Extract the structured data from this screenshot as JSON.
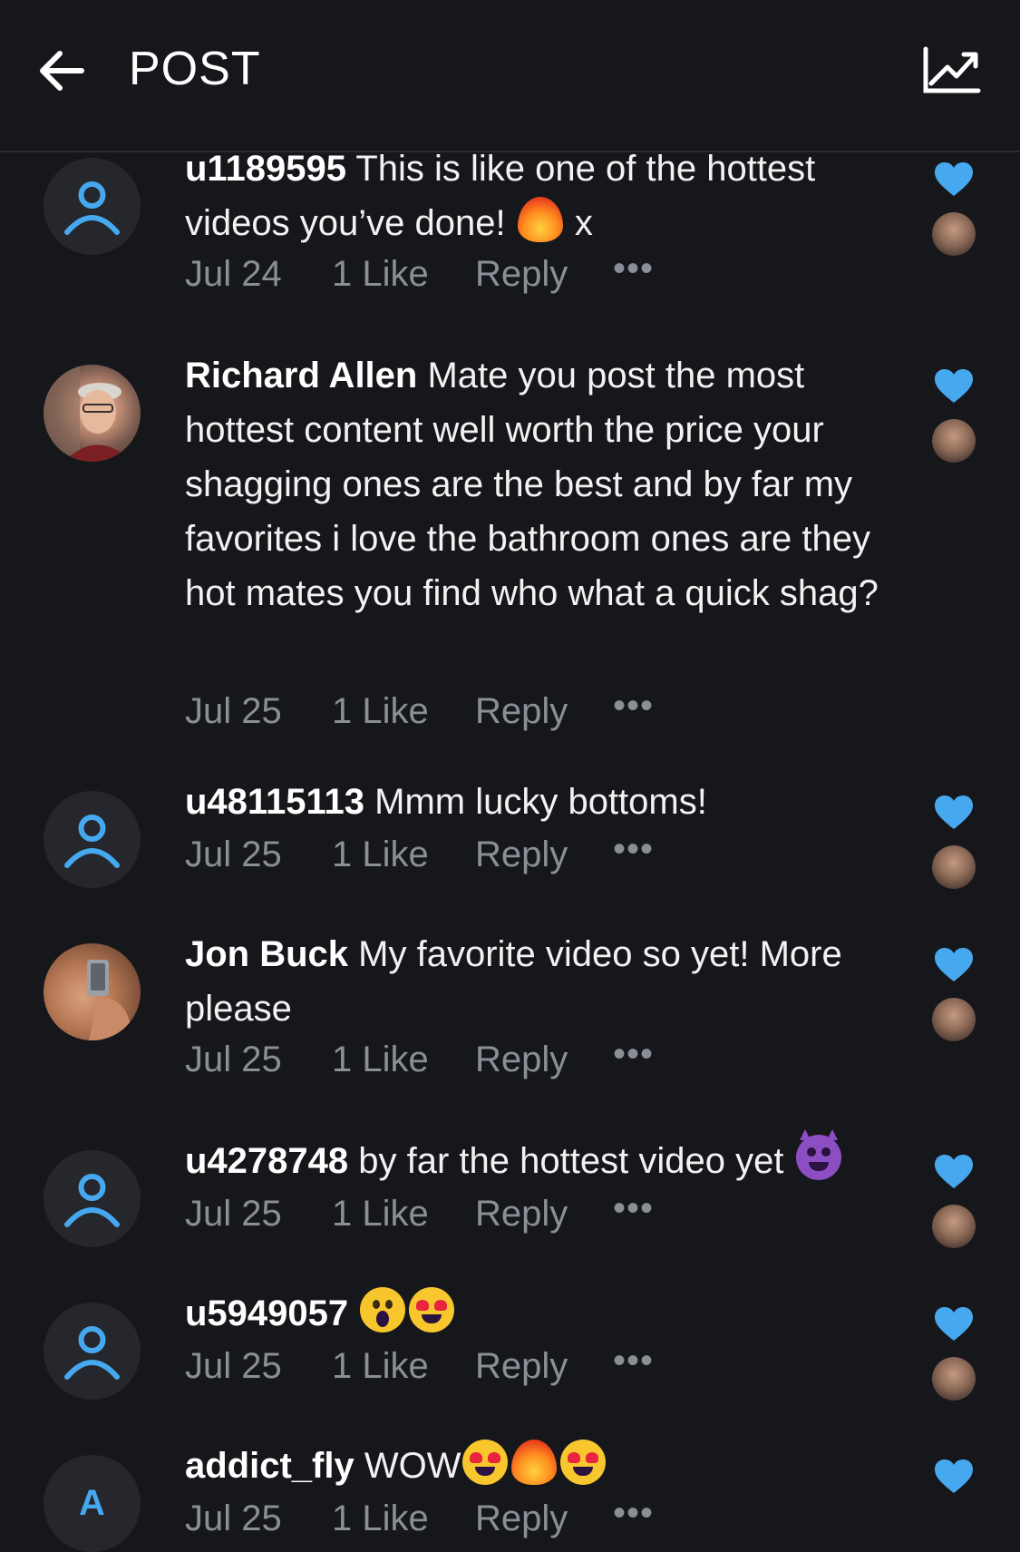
{
  "header": {
    "title": "POST",
    "back_icon": "arrow-left-icon",
    "stats_icon": "trending-up-icon"
  },
  "colors": {
    "background": "#16171b",
    "accent": "#46a8ee",
    "meta_text": "#8b8e96"
  },
  "comments": [
    {
      "username": "u1189595",
      "text": "This is like one of the hottest videos you’ve done!",
      "emoji_after": [
        "fire"
      ],
      "suffix": "x",
      "date": "Jul 24",
      "likes": "1 Like",
      "reply": "Reply",
      "more": "•••",
      "avatar": "default-user-icon"
    },
    {
      "username": "Richard Allen",
      "text": "Mate you post the most hottest content well worth the price your shagging ones are the best and by far my favorites i love the bathroom ones are they hot mates you find who what a quick shag?",
      "date": "Jul 25",
      "likes": "1 Like",
      "reply": "Reply",
      "more": "•••",
      "avatar": "photo"
    },
    {
      "username": "u48115113",
      "text": "Mmm lucky bottoms!",
      "date": "Jul 25",
      "likes": "1 Like",
      "reply": "Reply",
      "more": "•••",
      "avatar": "default-user-icon"
    },
    {
      "username": "Jon Buck",
      "text": "My favorite video so yet! More please",
      "date": "Jul 25",
      "likes": "1 Like",
      "reply": "Reply",
      "more": "•••",
      "avatar": "photo"
    },
    {
      "username": "u4278748",
      "text": "by far the hottest video yet",
      "emoji_after": [
        "smiling-devil"
      ],
      "date": "Jul 25",
      "likes": "1 Like",
      "reply": "Reply",
      "more": "•••",
      "avatar": "default-user-icon"
    },
    {
      "username": "u5949057",
      "text": "",
      "emoji_after": [
        "screaming-face",
        "heart-eyes"
      ],
      "date": "Jul 25",
      "likes": "1 Like",
      "reply": "Reply",
      "more": "•••",
      "avatar": "default-user-icon"
    },
    {
      "username": "addict_fly",
      "text": "WOW",
      "emoji_after": [
        "heart-eyes",
        "fire",
        "heart-eyes"
      ],
      "date": "Jul 25",
      "likes": "1 Like",
      "reply": "Reply",
      "more": "•••",
      "avatar": "letter",
      "avatar_letter": "A"
    }
  ]
}
